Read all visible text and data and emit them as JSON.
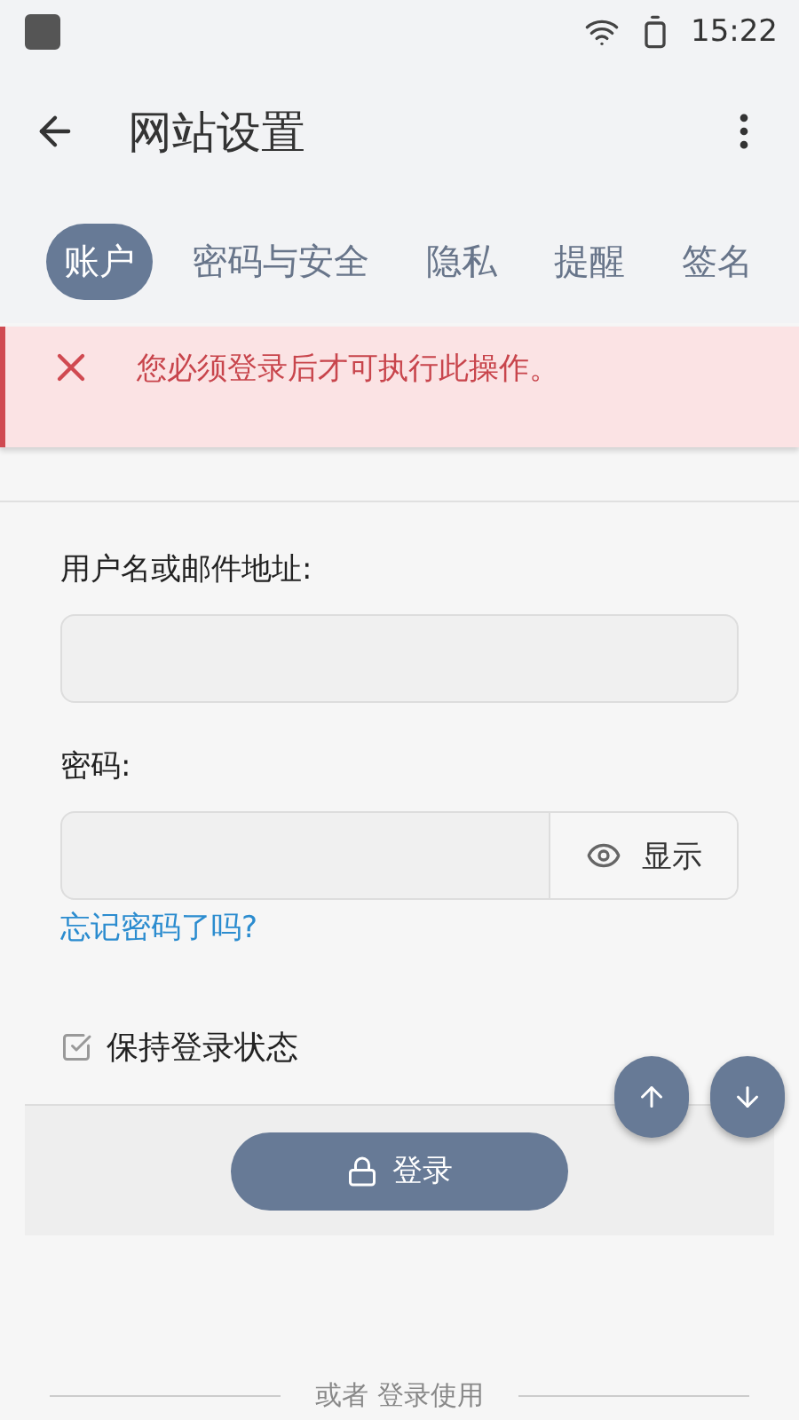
{
  "status_bar": {
    "time": "15:22"
  },
  "toolbar": {
    "title": "网站设置"
  },
  "tabs": [
    {
      "label": "账户",
      "selected": true
    },
    {
      "label": "密码与安全",
      "selected": false
    },
    {
      "label": "隐私",
      "selected": false
    },
    {
      "label": "提醒",
      "selected": false
    },
    {
      "label": "签名",
      "selected": false
    }
  ],
  "error": {
    "message": "您必须登录后才可执行此操作。"
  },
  "form": {
    "username_label": "用户名或邮件地址:",
    "password_label": "密码:",
    "show_button": "显示",
    "forgot_link": "忘记密码了吗?",
    "remember": {
      "label": "保持登录状态",
      "checked": true
    },
    "login_button": "登录"
  },
  "divider_text": "或者 登录使用"
}
